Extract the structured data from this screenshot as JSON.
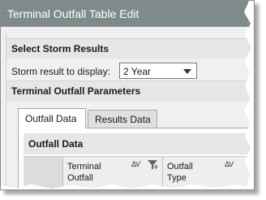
{
  "window": {
    "title": "Terminal Outfall Table Edit"
  },
  "storm_results": {
    "header": "Select Storm Results",
    "label": "Storm result to display:",
    "selected": "2 Year"
  },
  "parameters": {
    "header": "Terminal Outfall Parameters"
  },
  "tabs": [
    {
      "label": "Outfall Data",
      "active": true
    },
    {
      "label": "Results Data",
      "active": false
    }
  ],
  "panel": {
    "header": "Outfall Data"
  },
  "grid": {
    "columns": [
      {
        "title_line1": "Terminal",
        "title_line2": "Outfall",
        "sort": "ΔV"
      },
      {
        "title_line1": "Outfall",
        "title_line2": "Type",
        "sort": "ΔV"
      }
    ]
  }
}
